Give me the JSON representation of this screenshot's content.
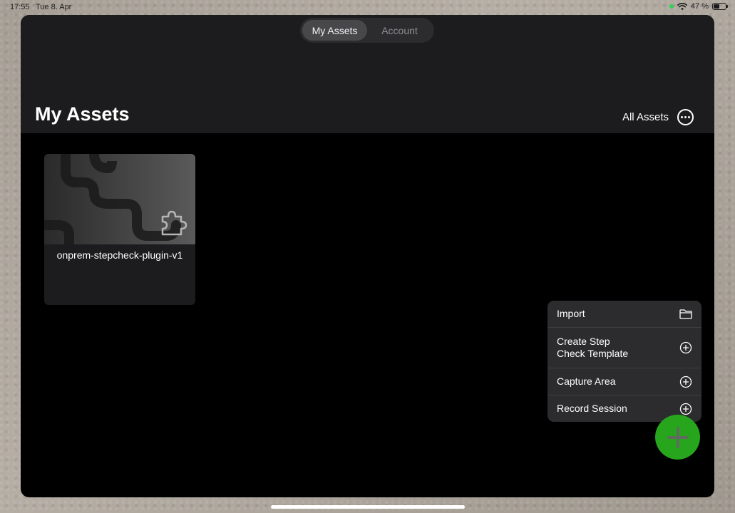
{
  "status_bar": {
    "time": "17:55",
    "date": "Tue 8. Apr",
    "battery_text": "47 %",
    "battery_level": 0.47
  },
  "tabs": [
    {
      "label": "My Assets",
      "active": true
    },
    {
      "label": "Account",
      "active": false
    }
  ],
  "header": {
    "title": "My Assets",
    "filter_label": "All Assets",
    "more_icon": "ellipsis-circle-icon"
  },
  "assets": [
    {
      "name": "onprem-stepcheck-plugin-v1",
      "icon": "puzzle-piece-icon"
    }
  ],
  "menu": {
    "items": [
      {
        "label": "Import",
        "icon": "folder-icon"
      },
      {
        "label": "Create Step\nCheck Template",
        "icon": "plus-circle-icon"
      },
      {
        "label": "Capture Area",
        "icon": "plus-circle-icon"
      },
      {
        "label": "Record Session",
        "icon": "plus-circle-icon"
      }
    ]
  },
  "fab": {
    "icon": "plus-icon"
  },
  "colors": {
    "accent_green": "#27a51d",
    "header_bg": "#1c1c1e",
    "menu_bg": "#2c2c2e"
  }
}
